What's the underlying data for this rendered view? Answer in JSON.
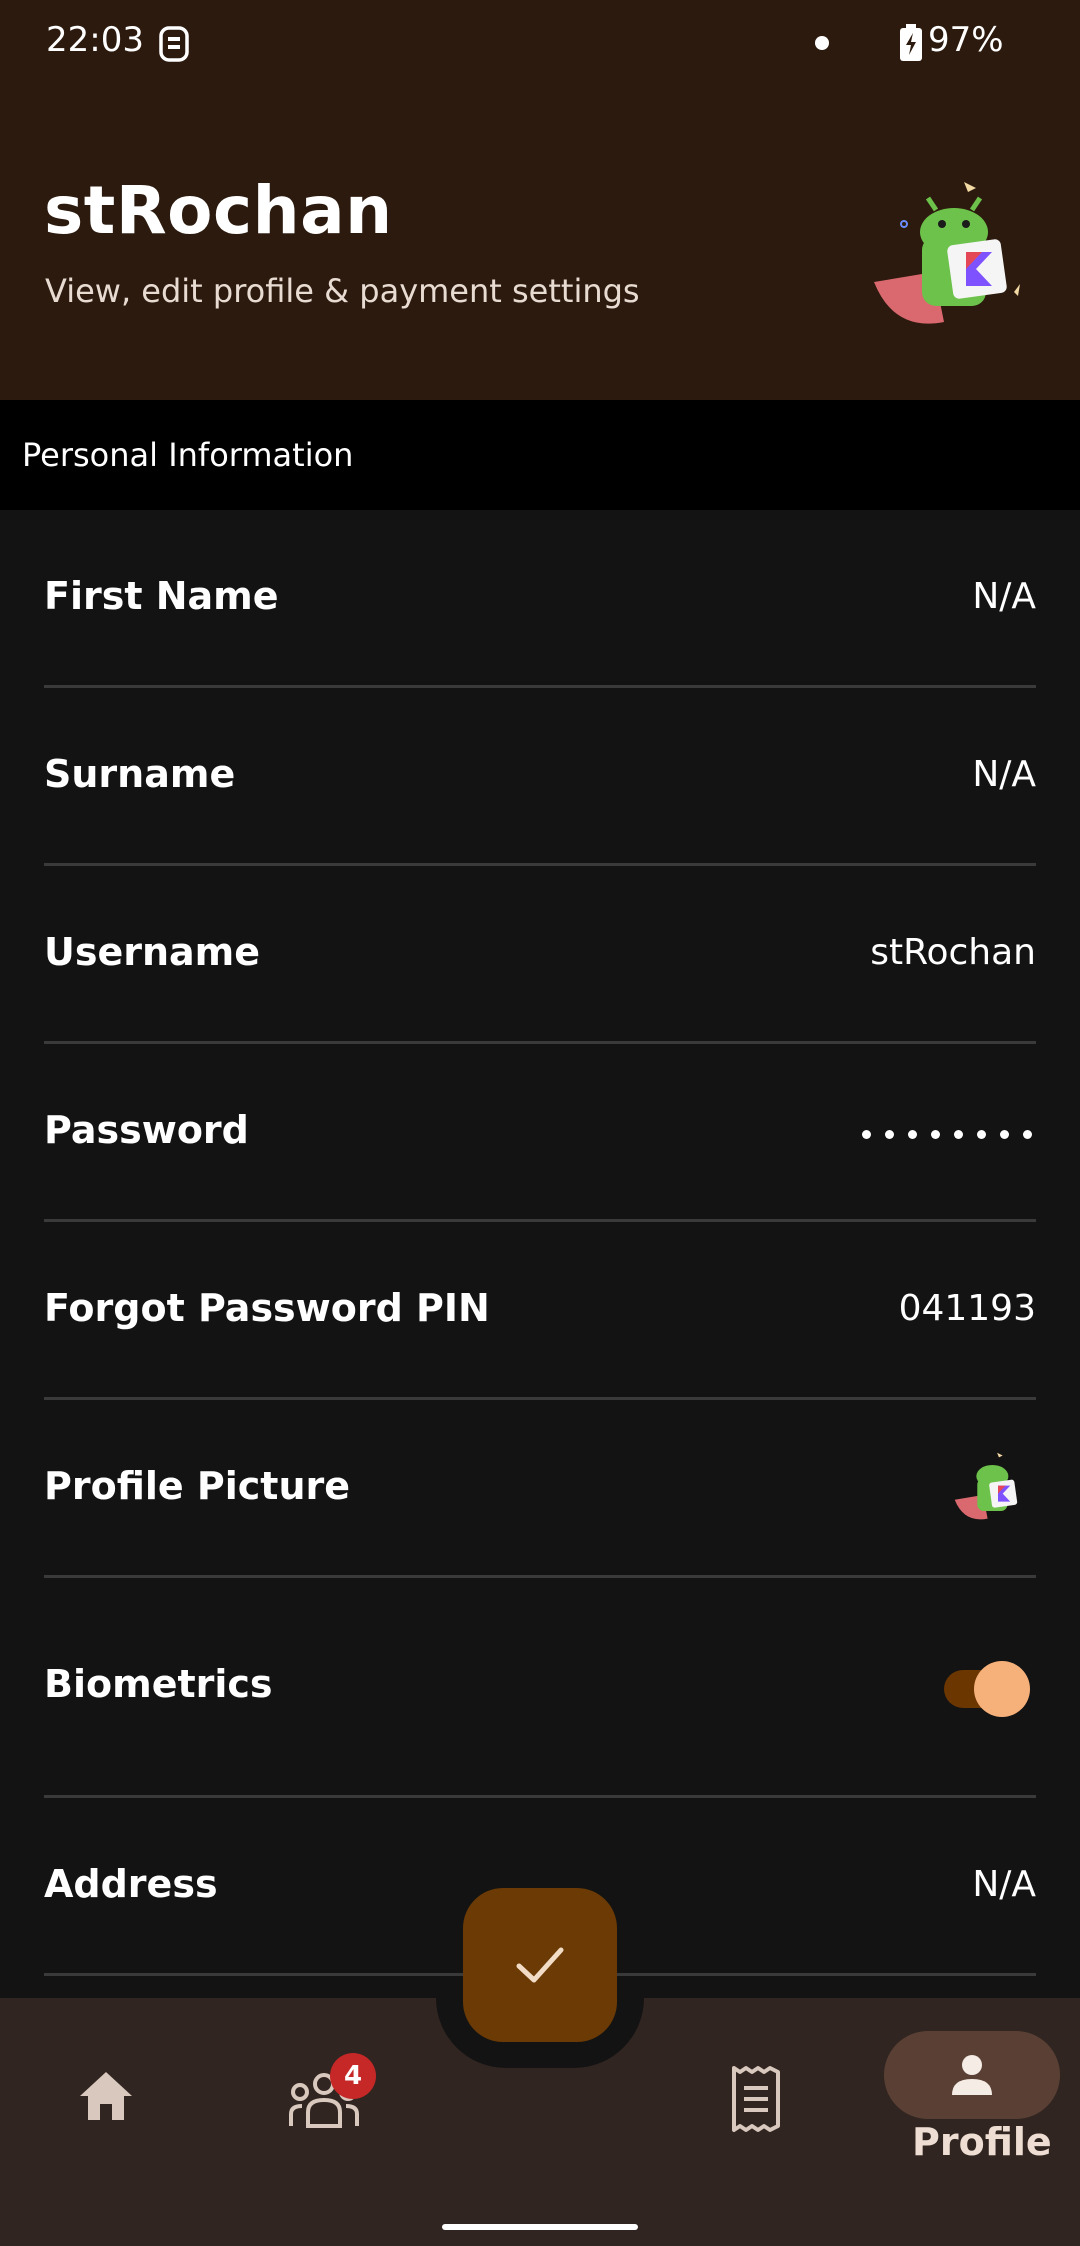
{
  "status_bar": {
    "time": "22:03",
    "battery_percent": "97%",
    "icons": [
      "sim-icon",
      "notification-dot-icon",
      "battery-charging-icon"
    ]
  },
  "header": {
    "title": "stRochan",
    "subtitle": "View, edit profile & payment settings",
    "image": "android-kotlin-mascot"
  },
  "section": {
    "title": "Personal Information"
  },
  "fields": [
    {
      "label": "First Name",
      "value": "N/A"
    },
    {
      "label": "Surname",
      "value": "N/A"
    },
    {
      "label": "Username",
      "value": "stRochan"
    },
    {
      "label": "Password",
      "value": "••••••••",
      "masked": true
    },
    {
      "label": "Forgot Password PIN",
      "value": "041193"
    },
    {
      "label": "Profile Picture",
      "value_image": "android-kotlin-mascot"
    },
    {
      "label": "Biometrics",
      "toggle_on": true
    },
    {
      "label": "Address",
      "value": "N/A"
    }
  ],
  "fab": {
    "icon": "check-icon"
  },
  "bottom_nav": {
    "items": [
      {
        "icon": "home-icon"
      },
      {
        "icon": "group-icon",
        "badge": "4"
      },
      {
        "icon": "receipt-icon"
      },
      {
        "icon": "person-icon",
        "label": "Profile",
        "active": true
      }
    ]
  },
  "colors": {
    "header_bg": "#2c1a0e",
    "accent": "#f6b07a",
    "fab_bg": "#6b3a05",
    "badge": "#c62828"
  }
}
